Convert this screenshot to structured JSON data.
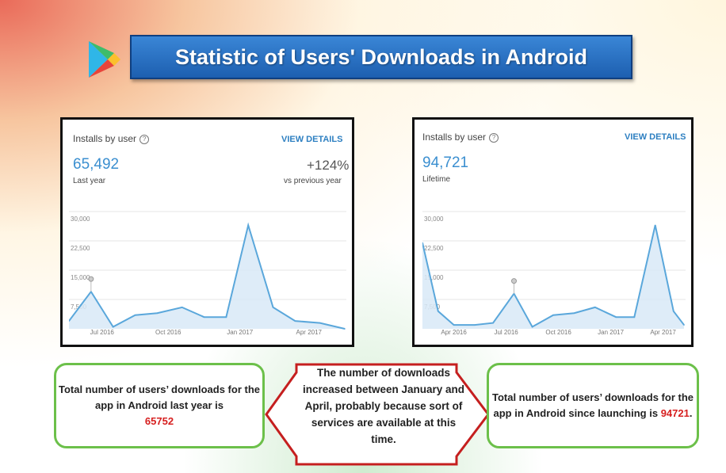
{
  "title": "Statistic of Users' Downloads in Android",
  "colors": {
    "line": "#5aa7db",
    "fill": "#d8e9f7",
    "title_bg": "#2a73c4",
    "callout_border": "#6cc04a",
    "arrow_border": "#c51f1f"
  },
  "left_panel": {
    "heading": "Installs by user",
    "help_icon": "?",
    "view_details": "VIEW DETAILS",
    "value": "65,492",
    "value_caption": "Last year",
    "change": "+124%",
    "change_caption": "vs previous year"
  },
  "right_panel": {
    "heading": "Installs by user",
    "help_icon": "?",
    "view_details": "VIEW DETAILS",
    "value": "94,721",
    "value_caption": "Lifetime"
  },
  "chart_data": [
    {
      "type": "area",
      "ylim": [
        0,
        30000
      ],
      "yticks": [
        "30,000",
        "22,500",
        "15,000",
        "7,500"
      ],
      "ytick_values": [
        30000,
        22500,
        15000,
        7500
      ],
      "xticks": [
        "Jul 2016",
        "Oct 2016",
        "Jan 2017",
        "Apr 2017"
      ],
      "xtick_pos": [
        0.12,
        0.36,
        0.62,
        0.87
      ],
      "x": [
        0,
        0.08,
        0.16,
        0.24,
        0.32,
        0.41,
        0.49,
        0.57,
        0.65,
        0.74,
        0.82,
        0.91,
        1.0
      ],
      "values": [
        2000,
        9500,
        500,
        3500,
        4000,
        5500,
        3000,
        3000,
        26500,
        5500,
        2000,
        1500,
        0
      ],
      "marker_index": 1
    },
    {
      "type": "area",
      "ylim": [
        0,
        30000
      ],
      "yticks": [
        "30,000",
        "22,500",
        "15,000",
        "7,500"
      ],
      "ytick_values": [
        30000,
        22500,
        15000,
        7500
      ],
      "xticks": [
        "Apr 2016",
        "Jul 2016",
        "Oct 2016",
        "Jan 2017",
        "Apr 2017"
      ],
      "xtick_pos": [
        0.12,
        0.32,
        0.52,
        0.72,
        0.92
      ],
      "x": [
        0,
        0.06,
        0.12,
        0.2,
        0.27,
        0.35,
        0.42,
        0.5,
        0.58,
        0.66,
        0.74,
        0.81,
        0.89,
        0.96,
        1.0
      ],
      "values": [
        22000,
        4500,
        1000,
        1000,
        1500,
        9000,
        500,
        3500,
        4000,
        5500,
        3000,
        3000,
        26500,
        4500,
        1000
      ],
      "marker_index": 5
    }
  ],
  "callouts": {
    "left_text": "Total number of users’ downloads for the app in Android last year is",
    "left_number": "65752",
    "middle_text": "The number of downloads increased between January and April, probably because sort of services are available at this time.",
    "right_text": "Total number of users’ downloads for the app in Android since launching is",
    "right_number": "94721",
    "right_suffix": "."
  }
}
